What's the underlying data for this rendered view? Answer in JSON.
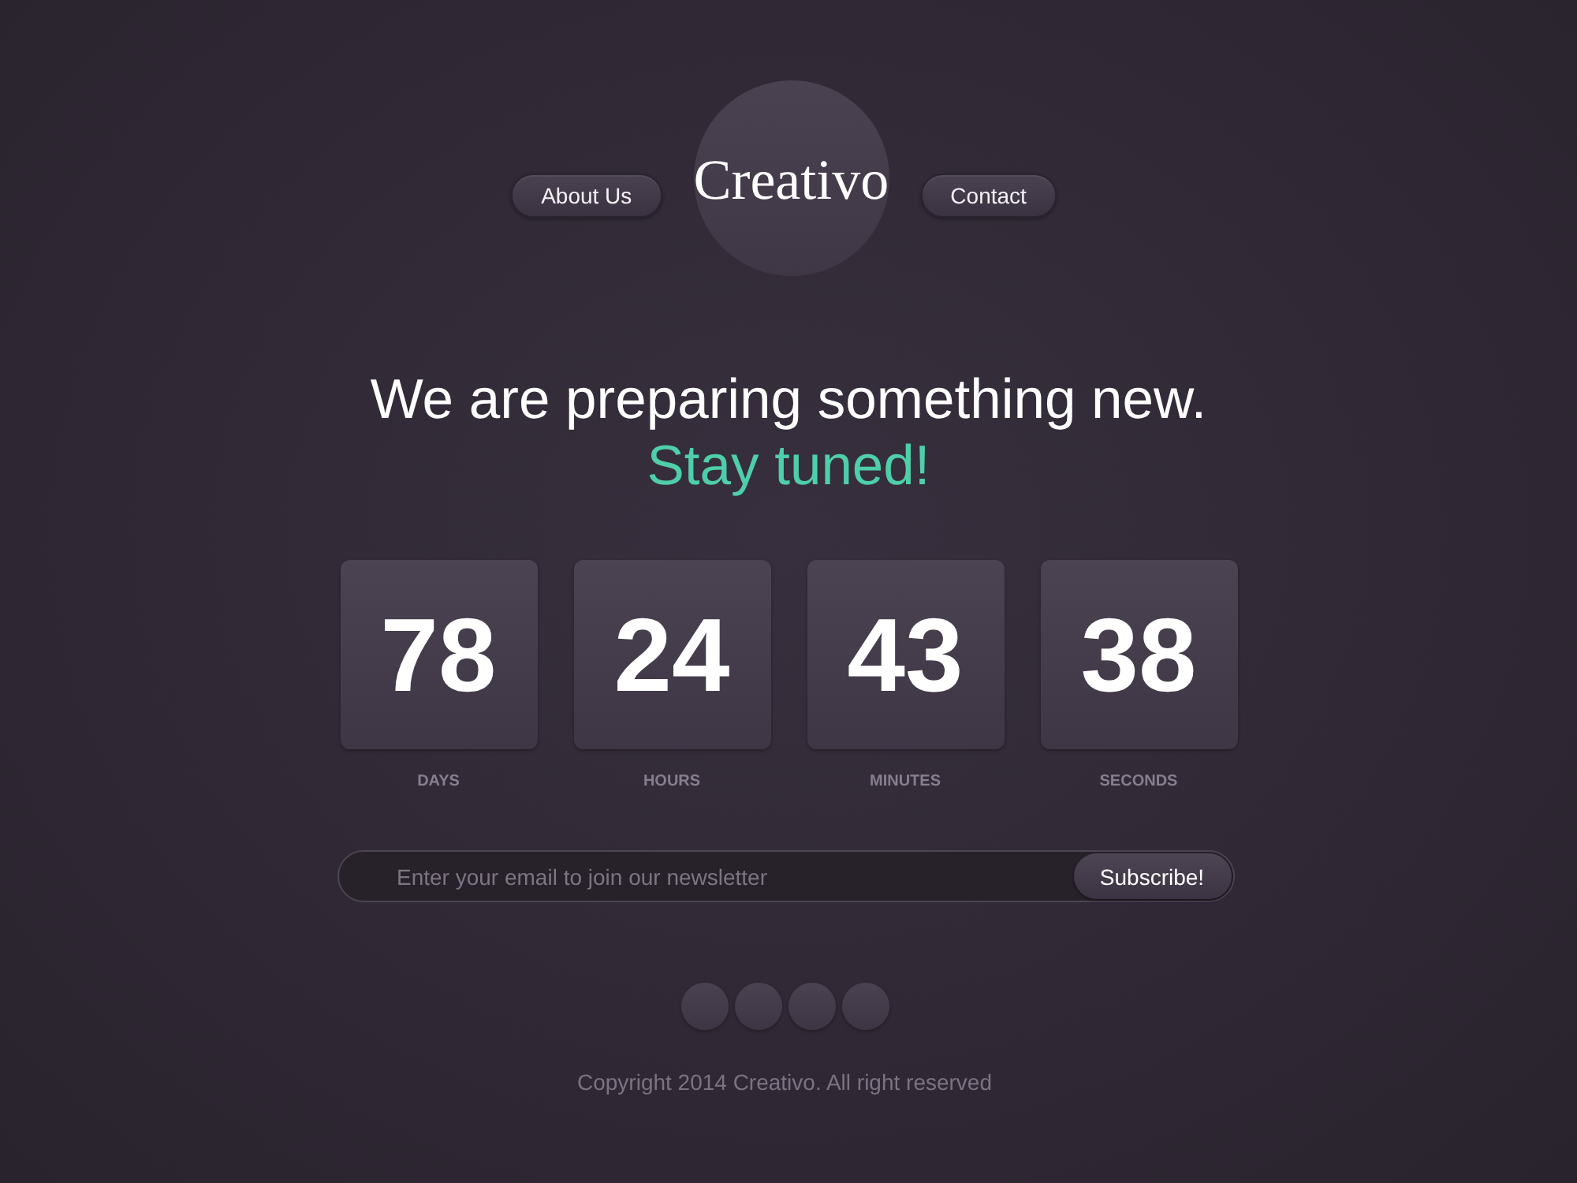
{
  "nav": [
    {
      "kind": "link",
      "label": "About Us"
    },
    {
      "kind": "logo",
      "label": "Creativo"
    },
    {
      "kind": "link",
      "label": "Contact"
    }
  ],
  "headline": {
    "line_1": "We are preparing something new.",
    "line_2": "Stay tuned!"
  },
  "countdown": [
    {
      "value": "78",
      "label": "DAYS"
    },
    {
      "value": "24",
      "label": "HOURS"
    },
    {
      "value": "43",
      "label": "MINUTES"
    },
    {
      "value": "38",
      "label": "SECONDS"
    }
  ],
  "newsletter": {
    "placeholder": "Enter your email to join our newsletter",
    "button": "Subscribe!"
  },
  "footer": {
    "copyright": "Copyright 2014 Creativo. All right reserved"
  }
}
